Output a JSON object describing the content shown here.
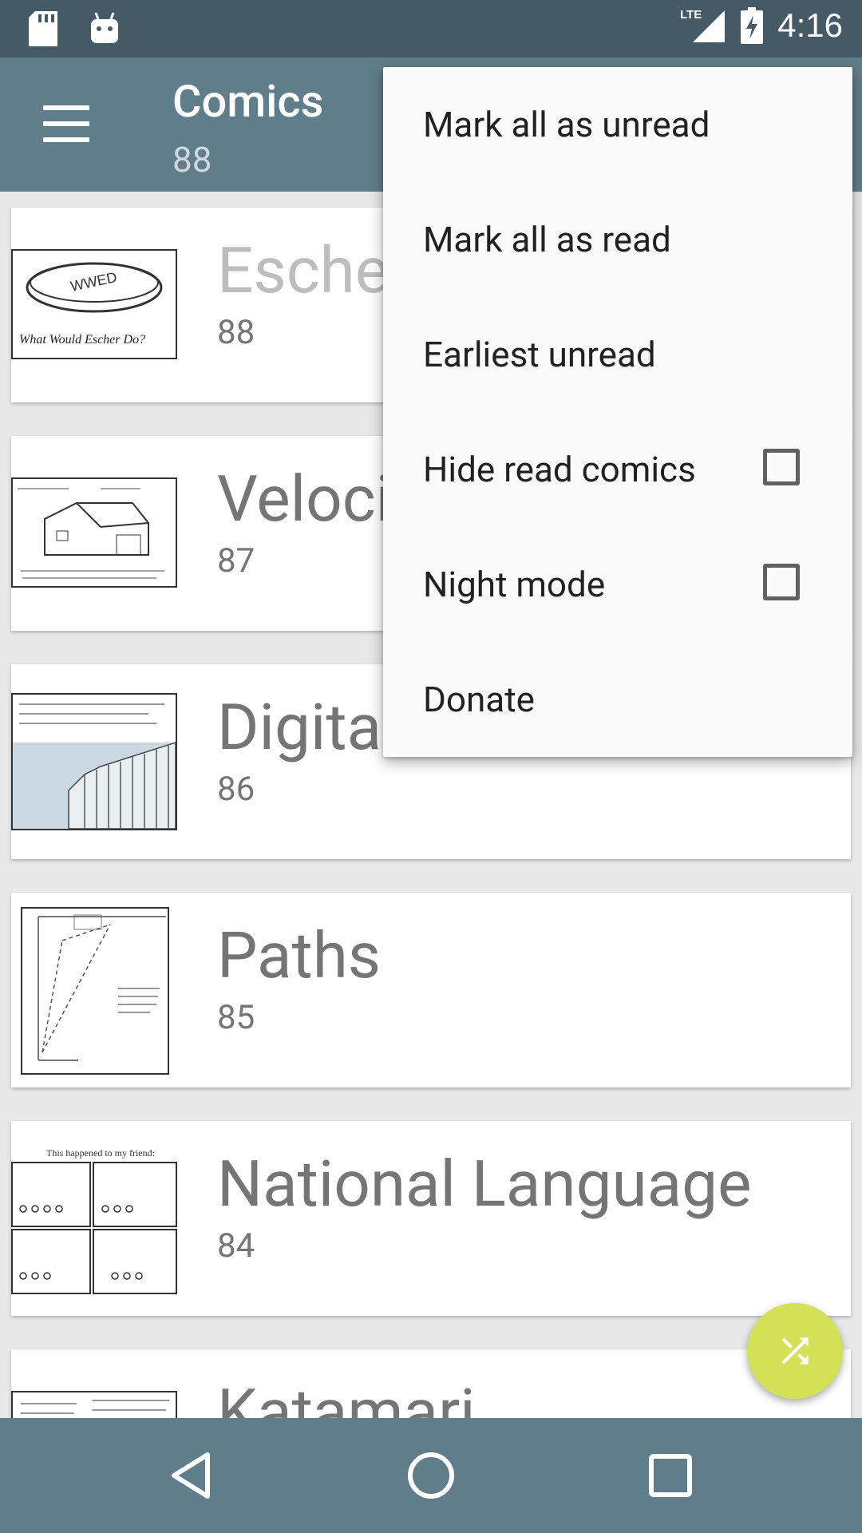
{
  "status_bar": {
    "time": "4:16",
    "network": "LTE"
  },
  "app_bar": {
    "title": "Comics",
    "subtitle": "88"
  },
  "comics": [
    {
      "title": "Esche",
      "number": "88",
      "thumb": "escher"
    },
    {
      "title": "Veloci",
      "number": "87",
      "thumb": "house"
    },
    {
      "title": "Digita",
      "number": "86",
      "thumb": "wall"
    },
    {
      "title": "Paths",
      "number": "85",
      "thumb": "paths"
    },
    {
      "title": "National Language",
      "number": "84",
      "thumb": "language"
    },
    {
      "title": "Katamari",
      "number": "",
      "thumb": "katamari"
    }
  ],
  "thumbnail_text": {
    "escher_band": "WWED",
    "escher_caption": "What Would Escher Do?",
    "language_caption": "This happened to my friend:"
  },
  "menu": {
    "items": [
      {
        "label": "Mark all as unread",
        "checkbox": false
      },
      {
        "label": "Mark all as read",
        "checkbox": false
      },
      {
        "label": "Earliest unread",
        "checkbox": false
      },
      {
        "label": "Hide read comics",
        "checkbox": true,
        "checked": false
      },
      {
        "label": "Night mode",
        "checkbox": true,
        "checked": false
      },
      {
        "label": "Donate",
        "checkbox": false
      }
    ]
  },
  "fab": {
    "icon": "shuffle-icon",
    "color": "#d4e157"
  },
  "colors": {
    "status_bar": "#455a64",
    "app_bar": "#607d8b",
    "nav_bar": "#607d8b"
  }
}
